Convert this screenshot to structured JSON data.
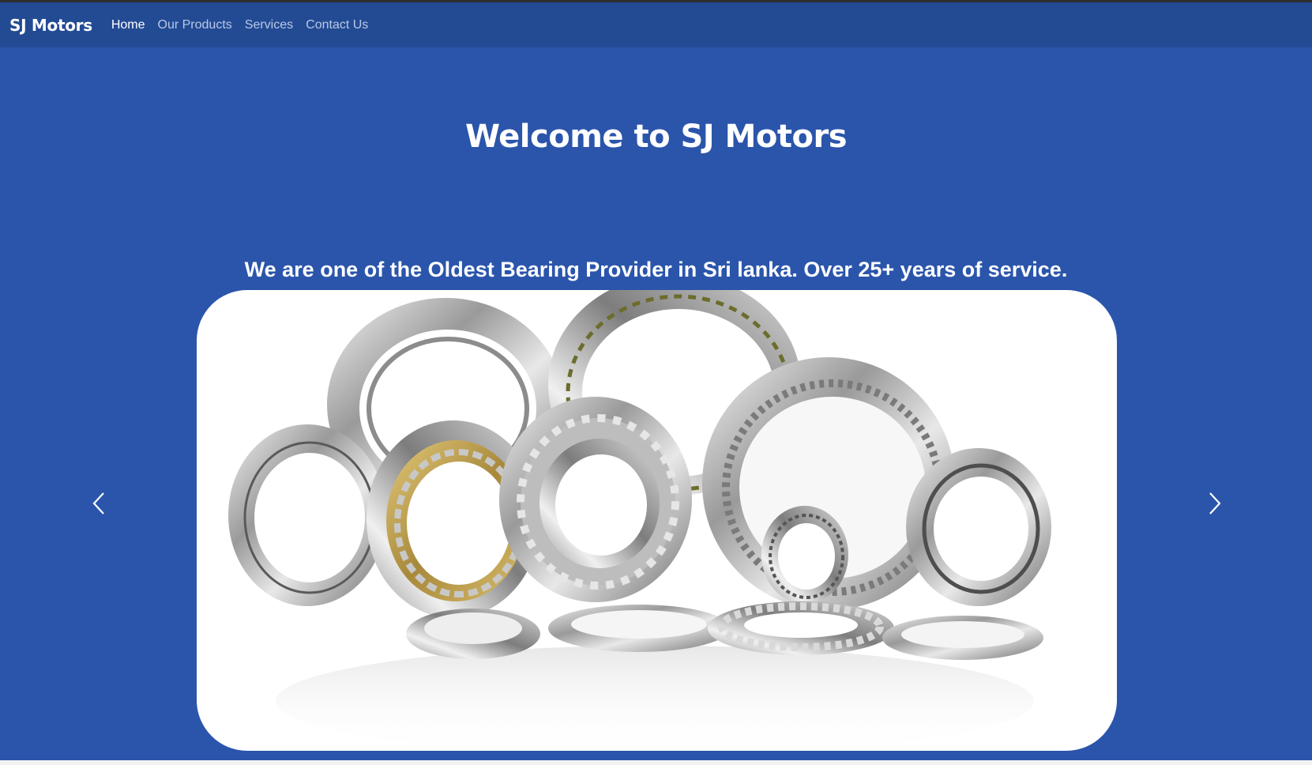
{
  "nav": {
    "brand": "SJ Motors",
    "links": [
      {
        "label": "Home",
        "active": true
      },
      {
        "label": "Our Products",
        "active": false
      },
      {
        "label": "Services",
        "active": false
      },
      {
        "label": "Contact Us",
        "active": false
      }
    ]
  },
  "hero": {
    "title": "Welcome to SJ Motors",
    "tagline": "We are one of the Oldest Bearing Provider in Sri lanka. Over 25+ years of service."
  },
  "carousel": {
    "prev_icon": "chevron-left-icon",
    "next_icon": "chevron-right-icon"
  },
  "colors": {
    "page_background": "#2b55ab",
    "navbar_background": "#234b94",
    "nav_active": "#ffffff",
    "nav_inactive": "#b9c8e6"
  }
}
